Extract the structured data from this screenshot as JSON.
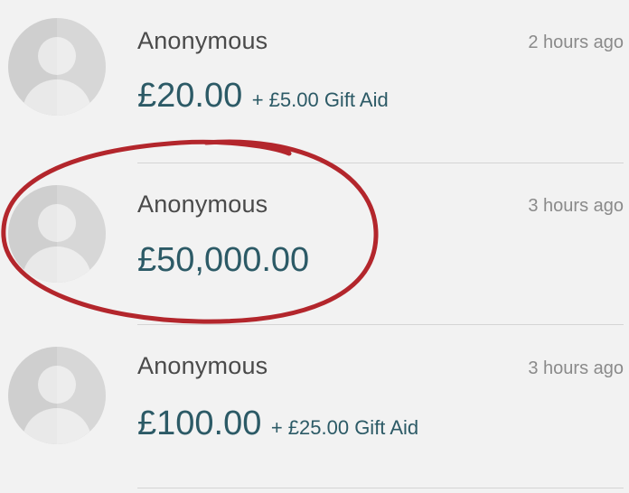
{
  "donations": [
    {
      "name": "Anonymous",
      "time": "2 hours ago",
      "amount": "£20.00",
      "gift_aid": "+ £5.00 Gift Aid"
    },
    {
      "name": "Anonymous",
      "time": "3 hours ago",
      "amount": "£50,000.00",
      "gift_aid": ""
    },
    {
      "name": "Anonymous",
      "time": "3 hours ago",
      "amount": "£100.00",
      "gift_aid": "+ £25.00 Gift Aid"
    }
  ],
  "colors": {
    "background": "#f2f2f2",
    "amount_text": "#2c5a66",
    "name_text": "#4a4a4a",
    "time_text": "#8a8a8a",
    "avatar_fill": "#cfcfcf",
    "highlight_ring": "#b3262c"
  },
  "icons": {
    "avatar": "default-user-avatar-icon"
  }
}
